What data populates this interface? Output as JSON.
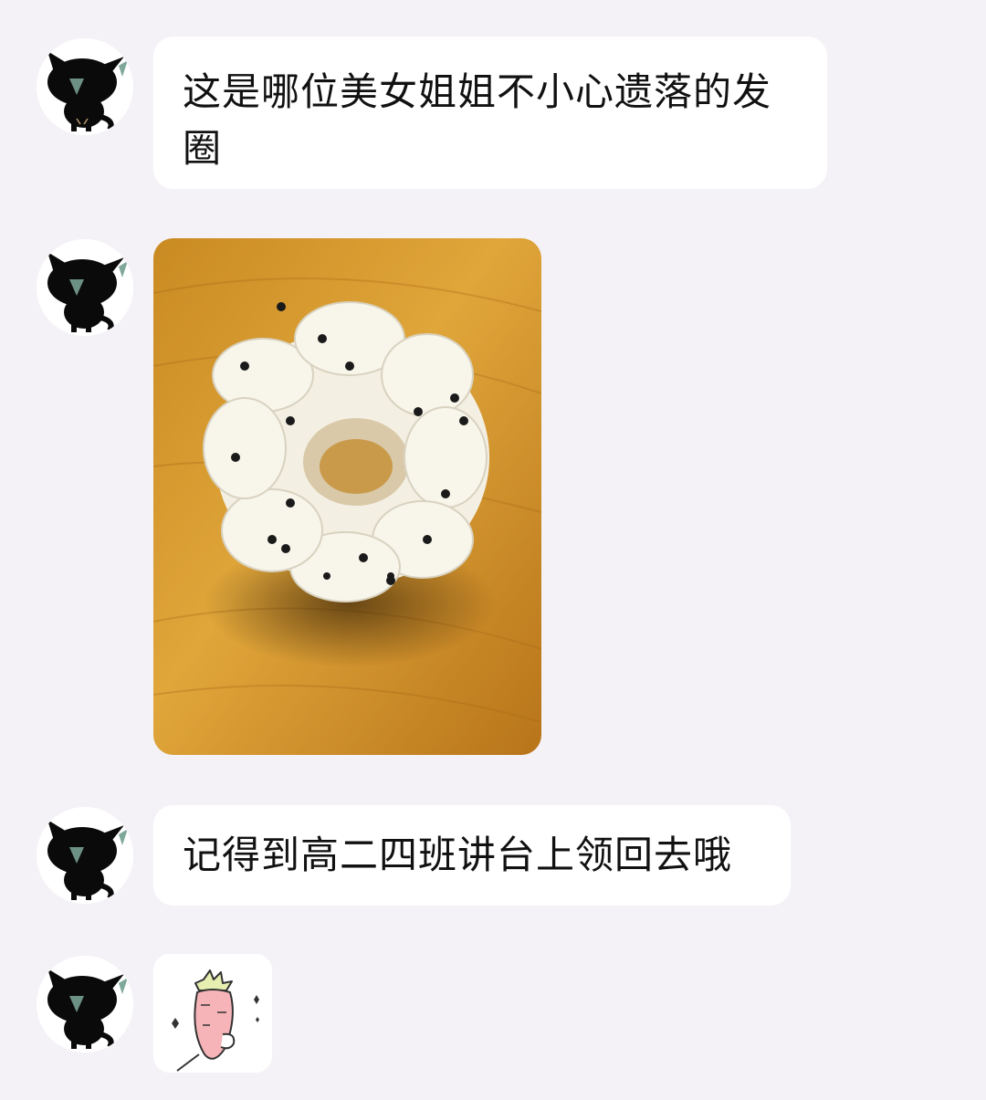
{
  "messages": [
    {
      "kind": "text",
      "avatar_icon": "black-cat-avatar-icon",
      "text": "这是哪位美女姐姐不小心遗落的发圈"
    },
    {
      "kind": "image",
      "avatar_icon": "black-cat-avatar-icon",
      "image_icon": "scrunchie-photo"
    },
    {
      "kind": "text",
      "avatar_icon": "black-cat-avatar-icon",
      "text": "记得到高二四班讲台上领回去哦"
    },
    {
      "kind": "sticker",
      "avatar_icon": "black-cat-avatar-icon",
      "sticker_icon": "carrot-sticker-icon"
    }
  ],
  "colors": {
    "background": "#f4f2f6",
    "bubble": "#ffffff",
    "text": "#111111",
    "wood": "#d99a2b",
    "avatar_cat": "#0a0a0a",
    "avatar_ear_accent": "#7fa89a"
  }
}
